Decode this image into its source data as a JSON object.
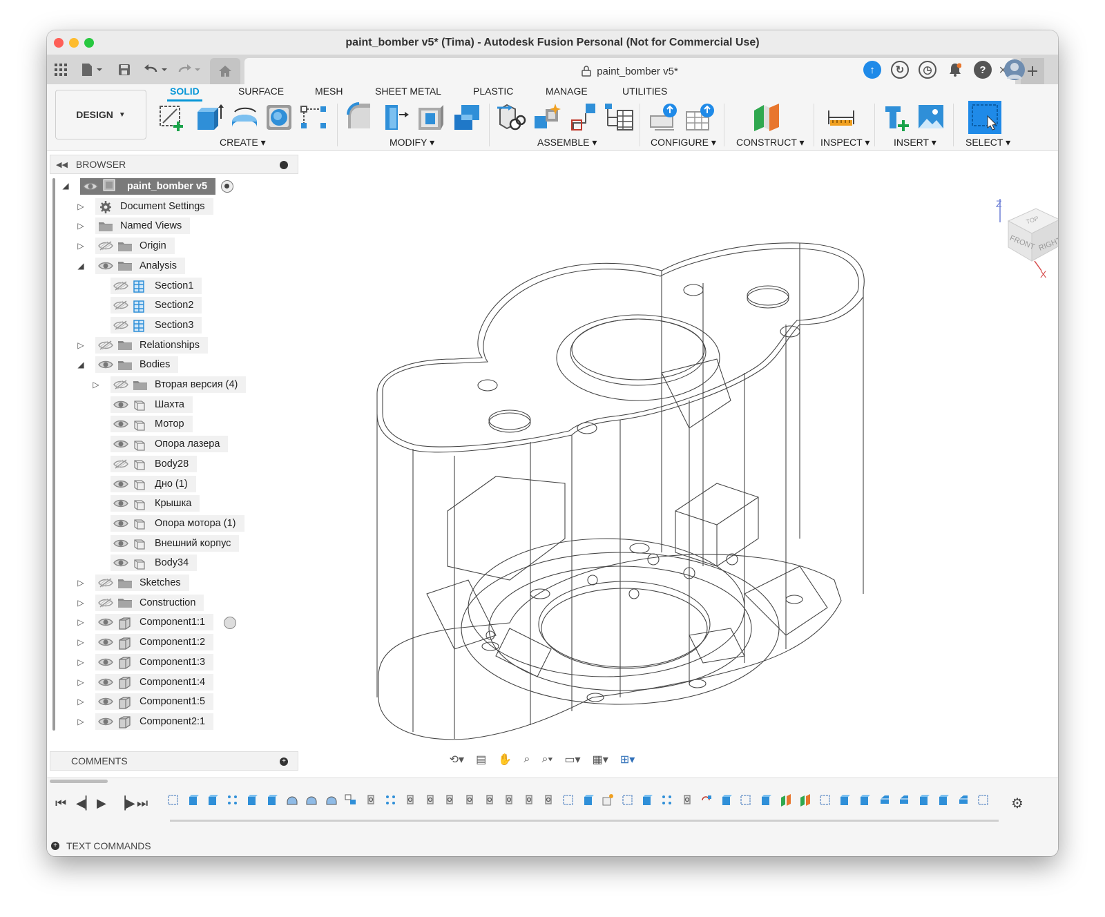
{
  "window": {
    "title": "paint_bomber v5* (Tima) - Autodesk Fusion Personal (Not for Commercial Use)"
  },
  "doc_tab": {
    "title": "paint_bomber v5*"
  },
  "workspace": {
    "label": "DESIGN"
  },
  "toolbar_tabs": [
    {
      "label": "SOLID",
      "active": true
    },
    {
      "label": "SURFACE"
    },
    {
      "label": "MESH"
    },
    {
      "label": "SHEET METAL"
    },
    {
      "label": "PLASTIC"
    },
    {
      "label": "MANAGE"
    },
    {
      "label": "UTILITIES"
    }
  ],
  "groups": [
    {
      "label": "CREATE"
    },
    {
      "label": "MODIFY"
    },
    {
      "label": "ASSEMBLE"
    },
    {
      "label": "CONFIGURE"
    },
    {
      "label": "CONSTRUCT"
    },
    {
      "label": "INSPECT"
    },
    {
      "label": "INSERT"
    },
    {
      "label": "SELECT"
    }
  ],
  "browser": {
    "title": "BROWSER",
    "root": "paint_bomber v5",
    "items": [
      {
        "label": "Document Settings",
        "icon": "gear"
      },
      {
        "label": "Named Views",
        "icon": "folder"
      },
      {
        "label": "Origin",
        "icon": "folder",
        "hidden": true
      },
      {
        "label": "Analysis",
        "icon": "folder",
        "expanded": true
      },
      {
        "label": "Section1",
        "icon": "section",
        "hidden": true
      },
      {
        "label": "Section2",
        "icon": "section",
        "hidden": true
      },
      {
        "label": "Section3",
        "icon": "section",
        "hidden": true
      },
      {
        "label": "Relationships",
        "icon": "folder",
        "hidden": true
      },
      {
        "label": "Bodies",
        "icon": "folder",
        "expanded": true
      },
      {
        "label": "Вторая версия (4)",
        "icon": "folder",
        "hidden": true
      },
      {
        "label": "Шахта",
        "icon": "body"
      },
      {
        "label": "Мотор",
        "icon": "body"
      },
      {
        "label": "Опора лазера",
        "icon": "body"
      },
      {
        "label": "Body28",
        "icon": "body",
        "hidden": true
      },
      {
        "label": "Дно (1)",
        "icon": "body"
      },
      {
        "label": "Крышка",
        "icon": "body"
      },
      {
        "label": "Опора мотора (1)",
        "icon": "body"
      },
      {
        "label": "Внешний корпус",
        "icon": "body"
      },
      {
        "label": "Body34",
        "icon": "body"
      },
      {
        "label": "Sketches",
        "icon": "folder",
        "hidden": true
      },
      {
        "label": "Construction",
        "icon": "folder",
        "hidden": true
      },
      {
        "label": "Component1:1",
        "icon": "component"
      },
      {
        "label": "Component1:2",
        "icon": "component"
      },
      {
        "label": "Component1:3",
        "icon": "component"
      },
      {
        "label": "Component1:4",
        "icon": "component"
      },
      {
        "label": "Component1:5",
        "icon": "component"
      },
      {
        "label": "Component2:1",
        "icon": "component"
      }
    ]
  },
  "comments": {
    "title": "COMMENTS"
  },
  "viewcube": {
    "top": "TOP",
    "front": "FRONT",
    "right": "RIGHT",
    "axis_z": "Z",
    "axis_x": "X"
  },
  "text_commands": {
    "label": "TEXT COMMANDS"
  },
  "colors": {
    "accent": "#0696d7",
    "tool_blue": "#2f8fd8",
    "root_row": "#7a7a7a"
  }
}
